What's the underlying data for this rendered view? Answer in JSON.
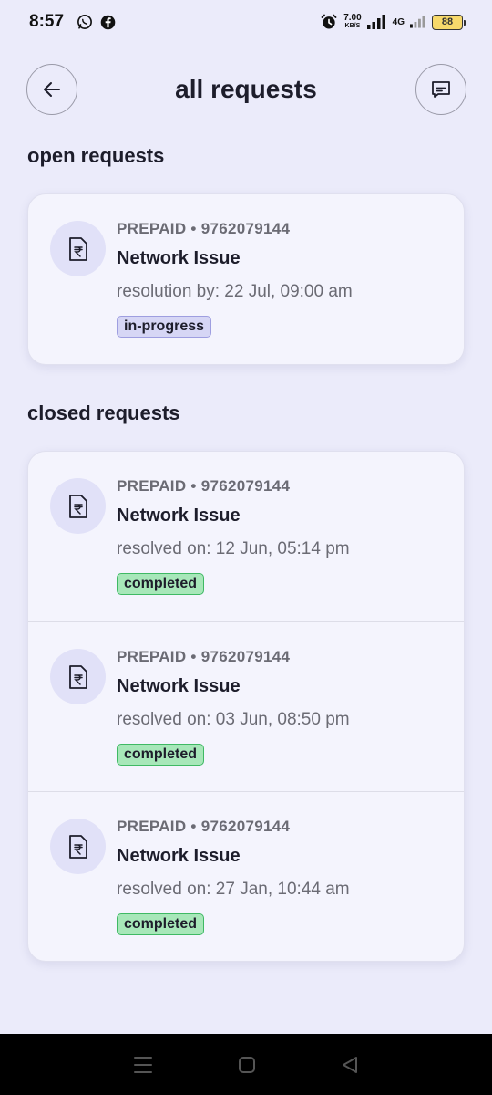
{
  "status_bar": {
    "time": "8:57",
    "net_speed_value": "7.00",
    "net_speed_unit": "KB/S",
    "network_type": "4G",
    "battery_level": "88"
  },
  "header": {
    "title": "all requests"
  },
  "open_section": {
    "title": "open requests",
    "items": [
      {
        "meta": "PREPAID • 9762079144",
        "title": "Network Issue",
        "date": "resolution by: 22 Jul, 09:00 am",
        "status": "in-progress"
      }
    ]
  },
  "closed_section": {
    "title": "closed requests",
    "items": [
      {
        "meta": "PREPAID • 9762079144",
        "title": "Network Issue",
        "date": "resolved on: 12 Jun, 05:14 pm",
        "status": "completed"
      },
      {
        "meta": "PREPAID • 9762079144",
        "title": "Network Issue",
        "date": "resolved on: 03 Jun, 08:50 pm",
        "status": "completed"
      },
      {
        "meta": "PREPAID • 9762079144",
        "title": "Network Issue",
        "date": "resolved on: 27 Jan, 10:44 am",
        "status": "completed"
      }
    ]
  },
  "icons": {
    "back": "arrow-left-icon",
    "chat": "chat-icon",
    "request": "rupee-document-icon"
  },
  "colors": {
    "background": "#ebebfa",
    "card": "#f4f4fd",
    "badge_progress": "#d6d6f5",
    "badge_completed": "#a7e7b9"
  }
}
